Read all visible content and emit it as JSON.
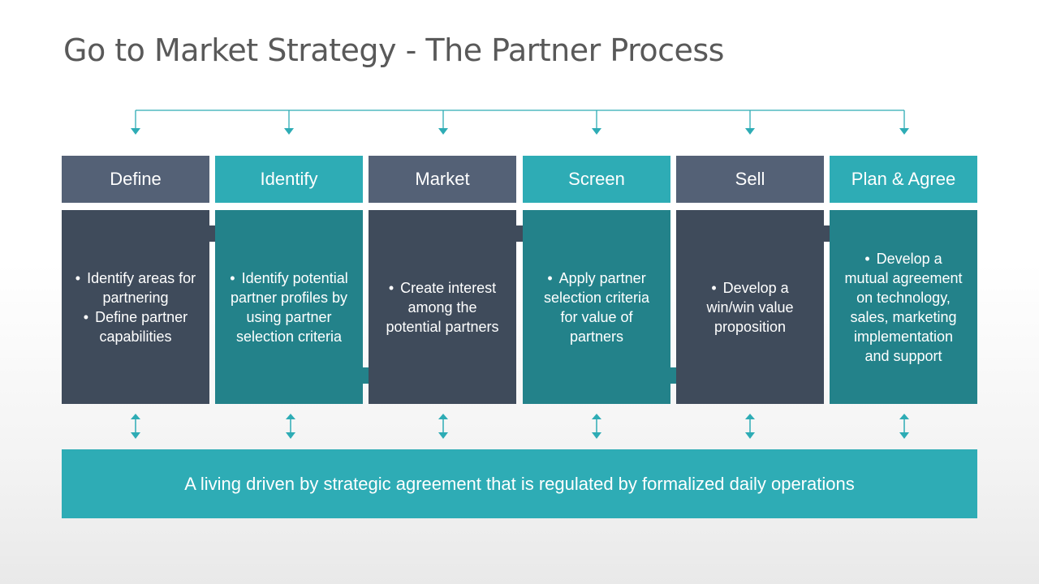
{
  "title": "Go to Market Strategy - The Partner Process",
  "colors": {
    "header_slate": "#546176",
    "header_teal": "#2eacb5",
    "body_slate": "#3f4b5b",
    "body_teal": "#23828a",
    "connector": "#2eacb5",
    "title_text": "#595959"
  },
  "steps": [
    {
      "label": "Define",
      "items": [
        "Identify areas for partnering",
        "Define partner capabilities"
      ]
    },
    {
      "label": "Identify",
      "items": [
        "Identify potential partner profiles by using partner selection criteria"
      ]
    },
    {
      "label": "Market",
      "items": [
        "Create interest among the potential partners"
      ]
    },
    {
      "label": "Screen",
      "items": [
        "Apply partner selection criteria for value of partners"
      ]
    },
    {
      "label": "Sell",
      "items": [
        "Develop a win/win value proposition"
      ]
    },
    {
      "label": "Plan & Agree",
      "items": [
        "Develop a mutual agreement on technology, sales, marketing implementation and support"
      ]
    }
  ],
  "banner": "A living driven by strategic agreement that is regulated by formalized daily operations",
  "icons": {
    "top_arrows": "arrow-down-icon",
    "flow_arrows": "arrow-right-icon",
    "link_arrows": "double-arrow-vertical-icon"
  }
}
